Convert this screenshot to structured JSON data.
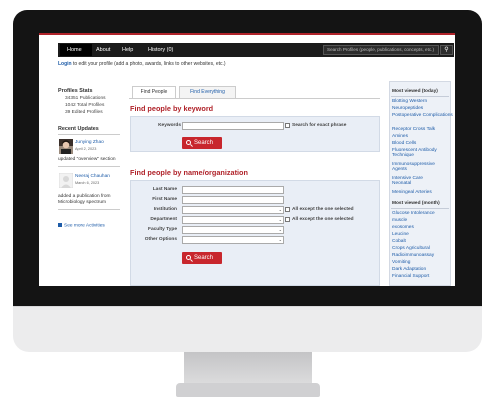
{
  "nav": {
    "home": "Home",
    "about": "About",
    "help": "Help",
    "history": "History (0)",
    "search_placeholder": "Search Profiles (people, publications, concepts, etc.)"
  },
  "login_line": {
    "link": "Login",
    "text": " to edit your profile (add a photo, awards, links to other websites, etc.)"
  },
  "profiles_stats": {
    "title": "Profiles Stats",
    "publications": "34351 Publications",
    "total_profiles": "1042 Total Profiles",
    "edited_profiles": "39 Edited Profiles"
  },
  "recent_updates": {
    "title": "Recent Updates",
    "items": [
      {
        "name": "Junying Zhao",
        "date": "April 2, 2023",
        "activity": "updated \"overview\" section"
      },
      {
        "name": "Neeraj Chauhan",
        "date": "March 6, 2023",
        "activity_line1": "added a publication from",
        "activity_line2": "Microbiology spectrum"
      }
    ],
    "see_more": "See more Activities"
  },
  "tabs": [
    "Find People",
    "Find Everything"
  ],
  "keyword_section": {
    "heading": "Find people by keyword",
    "keywords_label": "Keywords",
    "exact_phrase_label": "Search for exact phrase",
    "search_button": "Search"
  },
  "name_section": {
    "heading": "Find people by name/organization",
    "last_name": "Last Name",
    "first_name": "First Name",
    "institution": "Institution",
    "department": "Department",
    "faculty_type": "Faculty Type",
    "other_options": "Other Options",
    "all_except_institution": "All except the one selected",
    "all_except_department": "All except the one selected",
    "search_button": "Search"
  },
  "most_viewed_today": {
    "title": "Most viewed (today)",
    "links": [
      "Blotting Western",
      "Neuropeptides",
      "Postoperative Complications",
      "Receptor Cross Talk",
      "Amines",
      "Blood Cells",
      "Fluorescent Antibody Technique",
      "Immunosuppressive Agents",
      "Intensive Care Neonatal",
      "Meningeal Arteries"
    ]
  },
  "most_viewed_month": {
    "title": "Most viewed (month)",
    "links": [
      "Glucose Intolerance",
      "muscle",
      "exosomes",
      "Leucine",
      "Cobalt",
      "Crops Agricultural",
      "Radioimmunoassay",
      "Vomiting",
      "Dark Adaptation",
      "Financial Support"
    ]
  },
  "colors": {
    "accent_red": "#b0232a",
    "link_blue": "#1e5ca8",
    "navbar": "#1b1b1b"
  }
}
